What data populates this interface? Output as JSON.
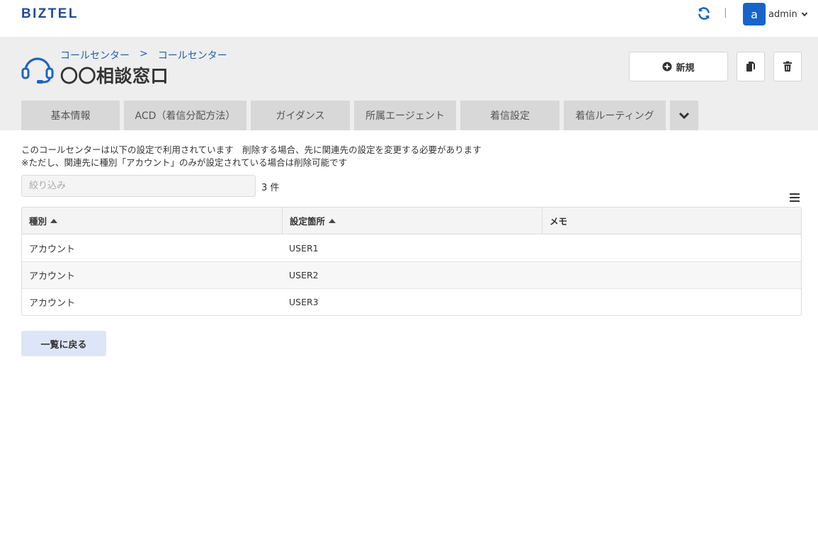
{
  "app": {
    "logo": "BIZTEL"
  },
  "user": {
    "avatar_letter": "a",
    "name": "admin"
  },
  "header": {
    "breadcrumbs": [
      "コールセンター",
      ">",
      "コールセンター"
    ],
    "title": "〇〇相談窓口",
    "new_label": "新規"
  },
  "tabs": [
    {
      "label": "基本情報"
    },
    {
      "label": "ACD（着信分配方法）"
    },
    {
      "label": "ガイダンス"
    },
    {
      "label": "所属エージェント"
    },
    {
      "label": "着信設定"
    },
    {
      "label": "着信ルーティング"
    }
  ],
  "notice": {
    "line1": "このコールセンターは以下の設定で利用されています　削除する場合、先に関連先の設定を変更する必要があります",
    "line2": "※ただし、関連先に種別「アカウント」のみが設定されている場合は削除可能です"
  },
  "filter": {
    "placeholder": "絞り込み",
    "value": "",
    "count": "3 件"
  },
  "table": {
    "columns": [
      "種別",
      "設定箇所",
      "メモ"
    ],
    "rows": [
      {
        "type": "アカウント",
        "location": "USER1",
        "memo": ""
      },
      {
        "type": "アカウント",
        "location": "USER2",
        "memo": ""
      },
      {
        "type": "アカウント",
        "location": "USER3",
        "memo": ""
      }
    ]
  },
  "back_label": "一覧に戻る",
  "colors": {
    "brand": "#1f4a9e",
    "accent": "#1864c8",
    "link": "#1a5fb4",
    "header_bg": "#eeeeee",
    "tab_bg": "#d8d8d8",
    "back_bg": "#dde6f8"
  },
  "icons": {
    "refresh": "refresh-icon",
    "caret": "chevron-down-icon",
    "headset": "headset-icon",
    "new": "plus-circle-icon",
    "copy": "copy-icon",
    "delete": "trash-icon",
    "more_tabs": "chevron-down-icon",
    "column_menu": "hamburger-icon",
    "sort": "sort-up-icon"
  }
}
